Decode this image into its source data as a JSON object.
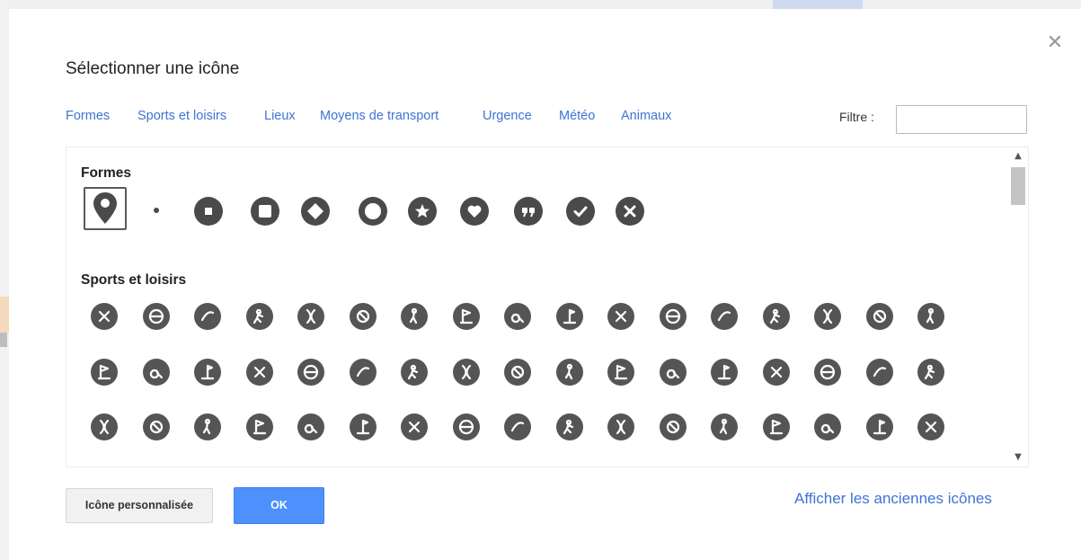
{
  "dialog": {
    "title": "Sélectionner une icône",
    "close_icon": "close-icon"
  },
  "tabs": [
    {
      "label": "Formes"
    },
    {
      "label": "Sports et loisirs"
    },
    {
      "label": "Lieux"
    },
    {
      "label": "Moyens de transport"
    },
    {
      "label": "Urgence"
    },
    {
      "label": "Météo"
    },
    {
      "label": "Animaux"
    }
  ],
  "filter": {
    "label": "Filtre :",
    "value": "",
    "placeholder": ""
  },
  "sections": {
    "formes": {
      "title": "Formes",
      "icons": [
        "placemark-pin-icon",
        "small-dot-icon",
        "square-in-circle-icon",
        "rounded-square-icon",
        "diamond-in-circle-icon",
        "ring-icon",
        "star-icon",
        "heart-icon",
        "quote-icon",
        "checkmark-icon",
        "x-mark-icon"
      ],
      "selected_icon": "placemark-pin-icon"
    },
    "sports": {
      "title": "Sports et loisirs",
      "rows": [
        [
          "baseball-icon",
          "basketball-icon",
          "american-football-icon",
          "soccer-player-icon",
          "volleyball-icon",
          "volleyball-ball-icon",
          "bowling-player-icon",
          "golf-icon",
          "magnifier-tennis-icon",
          "golf-hole-icon",
          "badminton-shuttlecock-icon",
          "tennis-racket-icon",
          "table-tennis-icon",
          "boxing-glove-icon",
          "martial-arts-icon",
          "fencing-icon",
          "weightlifting-icon"
        ],
        [
          "racing-flag-icon",
          "wrestling-icon",
          "horse-riding-icon",
          "bowling-ball-icon",
          "target-icon",
          "hockey-icon",
          "archery-icon",
          "running-icon",
          "hiking-icon",
          "cycling-icon",
          "trail-running-icon",
          "climbing-rope-icon",
          "rock-climbing-icon",
          "gymnastics-icon",
          "disc-icon",
          "skating-icon",
          "paragliding-icon"
        ],
        [
          "hang-gliding-icon",
          "ice-hockey-icon",
          "ice-skate-icon",
          "skiing-icon",
          "cross-country-ski-icon",
          "snowboard-icon",
          "sledding-icon",
          "ski-jumping-icon",
          "snowshoe-icon",
          "jet-ski-icon",
          "rowing-icon",
          "swimming-icon",
          "sailing-icon",
          "boat-icon",
          "windsurf-icon",
          "surfing-icon",
          "water-ski-icon"
        ]
      ]
    }
  },
  "scrollbar": {
    "up_icon": "scroll-up-arrow-icon",
    "down_icon": "scroll-down-arrow-icon"
  },
  "footer": {
    "custom_button": "Icône personnalisée",
    "ok_button": "OK",
    "old_icons_link": "Afficher les anciennes icônes"
  },
  "colors": {
    "link_blue": "#3f73d3",
    "ok_blue": "#4d90fe",
    "icon_gray": "#555555"
  }
}
